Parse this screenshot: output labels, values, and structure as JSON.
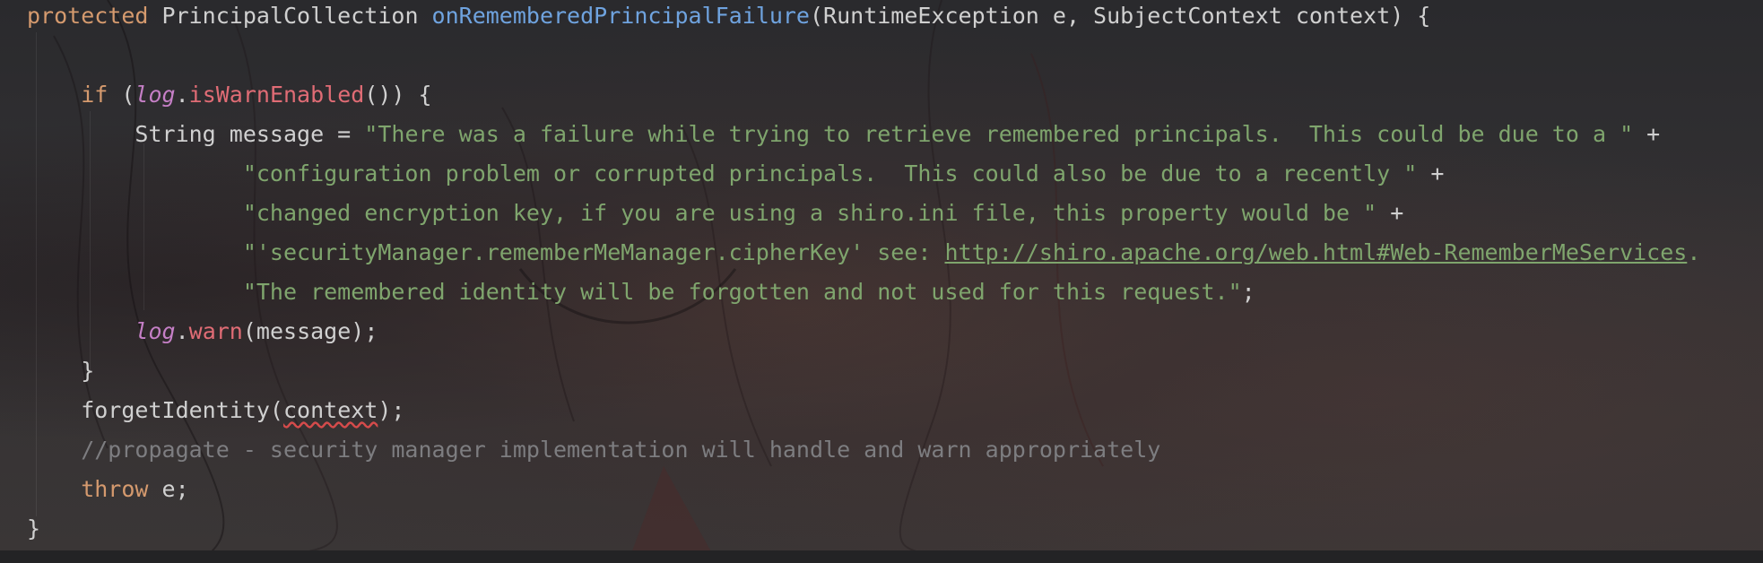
{
  "editor": {
    "language": "Java",
    "lines": [
      {
        "tokens": [
          {
            "t": "protected ",
            "c": "kw"
          },
          {
            "t": "PrincipalCollection ",
            "c": "plain"
          },
          {
            "t": "onRememberedPrincipalFailure",
            "c": "fn"
          },
          {
            "t": "(RuntimeException e, SubjectContext context) {",
            "c": "plain"
          }
        ]
      },
      {
        "tokens": []
      },
      {
        "tokens": [
          {
            "t": "    if ",
            "c": "kw"
          },
          {
            "t": "(",
            "c": "plain"
          },
          {
            "t": "log",
            "c": "field"
          },
          {
            "t": ".",
            "c": "plain"
          },
          {
            "t": "isWarnEnabled",
            "c": "call"
          },
          {
            "t": "()) {",
            "c": "plain"
          }
        ]
      },
      {
        "tokens": [
          {
            "t": "        String message = ",
            "c": "plain"
          },
          {
            "t": "\"There was a failure while trying to retrieve remembered principals.  This could be due to a \"",
            "c": "str"
          },
          {
            "t": " +",
            "c": "plain"
          }
        ]
      },
      {
        "tokens": [
          {
            "t": "                \"configuration problem or corrupted principals.  This could also be due to a recently \"",
            "c": "str"
          },
          {
            "t": " +",
            "c": "plain"
          }
        ]
      },
      {
        "tokens": [
          {
            "t": "                \"changed encryption key, if you are using a shiro.ini file, this property would be \"",
            "c": "str"
          },
          {
            "t": " +",
            "c": "plain"
          }
        ]
      },
      {
        "tokens": [
          {
            "t": "                \"'securityManager.rememberMeManager.cipherKey' see: ",
            "c": "str"
          },
          {
            "t": "http://shiro.apache.org/web.html#Web-RememberMeServices",
            "c": "link"
          },
          {
            "t": ". ",
            "c": "str"
          }
        ]
      },
      {
        "tokens": [
          {
            "t": "                \"The remembered identity will be forgotten and not used for this request.\"",
            "c": "str"
          },
          {
            "t": ";",
            "c": "plain"
          }
        ]
      },
      {
        "tokens": [
          {
            "t": "        ",
            "c": "plain"
          },
          {
            "t": "log",
            "c": "field"
          },
          {
            "t": ".",
            "c": "plain"
          },
          {
            "t": "warn",
            "c": "call"
          },
          {
            "t": "(message);",
            "c": "plain"
          }
        ]
      },
      {
        "tokens": [
          {
            "t": "    }",
            "c": "plain"
          }
        ]
      },
      {
        "tokens": [
          {
            "t": "    forgetIdentity(",
            "c": "plain"
          },
          {
            "t": "context",
            "c": "plain squiggle"
          },
          {
            "t": ");",
            "c": "plain"
          }
        ]
      },
      {
        "tokens": [
          {
            "t": "    //propagate - security manager implementation will handle and warn appropriately",
            "c": "cm"
          }
        ]
      },
      {
        "tokens": [
          {
            "t": "    throw ",
            "c": "kw"
          },
          {
            "t": "e;",
            "c": "plain"
          }
        ]
      },
      {
        "tokens": [
          {
            "t": "}",
            "c": "plain"
          }
        ]
      }
    ]
  }
}
